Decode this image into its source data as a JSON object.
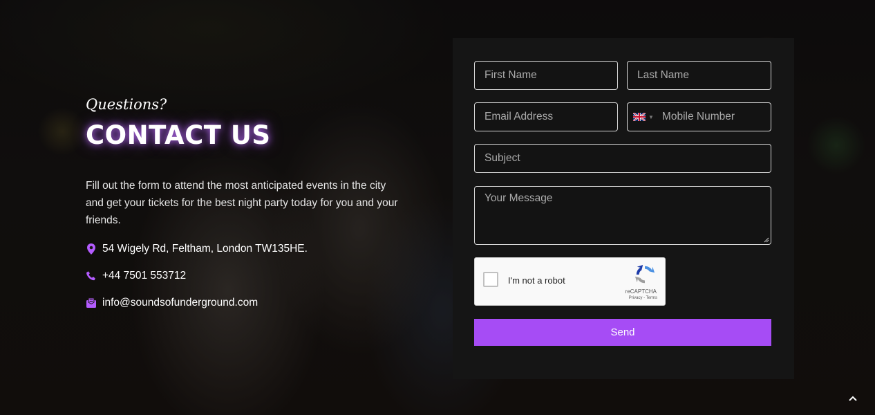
{
  "hero": {
    "kicker": "Questions?",
    "title": "CONTACT US",
    "intro": "Fill out the form to attend the most anticipated events in the city and get your tickets for the best night party today for you and your friends."
  },
  "contact": {
    "address": "54 Wigely Rd, Feltham, London TW135HE.",
    "phone": "+44 7501 553712",
    "email": "info@soundsofunderground.com"
  },
  "form": {
    "first_name_placeholder": "First Name",
    "last_name_placeholder": "Last Name",
    "email_placeholder": "Email Address",
    "mobile_placeholder": "Mobile Number",
    "country_flag": "uk-flag-icon",
    "subject_placeholder": "Subject",
    "message_placeholder": "Your Message",
    "captcha_label": "I'm not a robot",
    "captcha_brand": "reCAPTCHA",
    "captcha_links": "Privacy - Terms",
    "send_label": "Send"
  },
  "icons": {
    "address": "map-pin-icon",
    "phone": "phone-icon",
    "email": "envelope-icon",
    "scroll_top": "chevron-up-icon"
  },
  "colors": {
    "accent": "#a64cf5",
    "icon": "#b45cff",
    "form_bg": "#151515"
  }
}
